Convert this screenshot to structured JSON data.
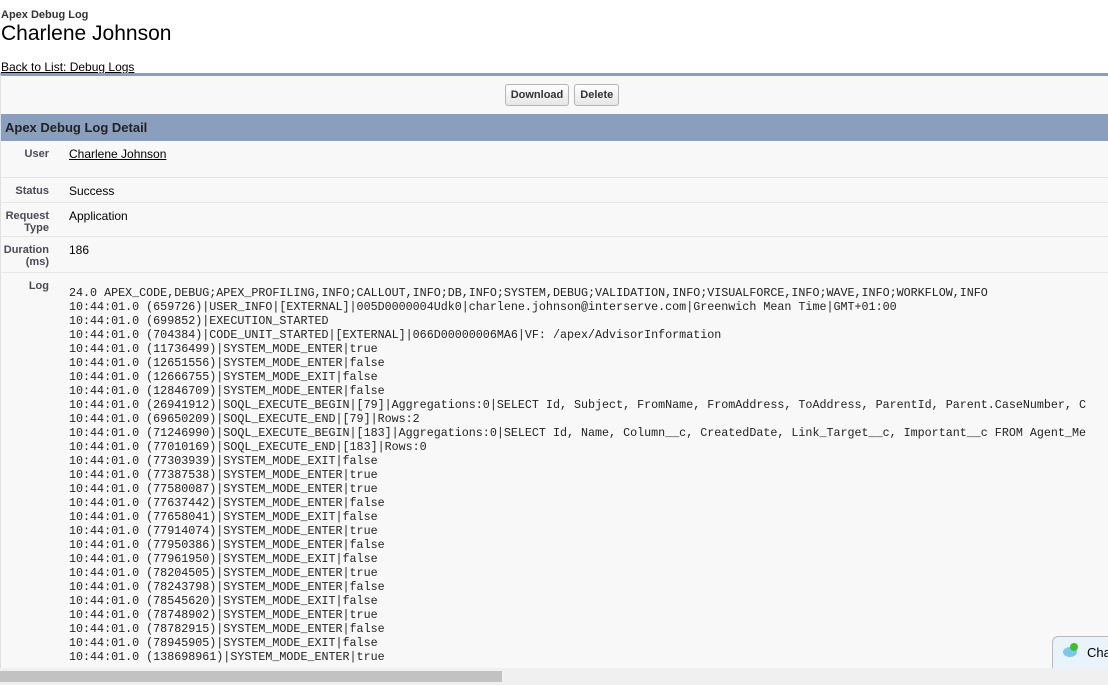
{
  "header": {
    "subtitle": "Apex Debug Log",
    "title": "Charlene Johnson",
    "back_link": "Back to List: Debug Logs"
  },
  "buttons": {
    "download": "Download",
    "delete": "Delete"
  },
  "section_title": "Apex Debug Log Detail",
  "fields": {
    "user_label": "User",
    "user_value": "Charlene Johnson",
    "status_label": "Status",
    "status_value": "Success",
    "request_type_label": "Request Type",
    "request_type_value": "Application",
    "duration_label": "Duration (ms)",
    "duration_value": "186",
    "log_label": "Log"
  },
  "log_lines": [
    "24.0 APEX_CODE,DEBUG;APEX_PROFILING,INFO;CALLOUT,INFO;DB,INFO;SYSTEM,DEBUG;VALIDATION,INFO;VISUALFORCE,INFO;WAVE,INFO;WORKFLOW,INFO",
    "10:44:01.0 (659726)|USER_INFO|[EXTERNAL]|005D0000004Udk0|charlene.johnson@interserve.com|Greenwich Mean Time|GMT+01:00",
    "10:44:01.0 (699852)|EXECUTION_STARTED",
    "10:44:01.0 (704384)|CODE_UNIT_STARTED|[EXTERNAL]|066D00000006MA6|VF: /apex/AdvisorInformation",
    "10:44:01.0 (11736499)|SYSTEM_MODE_ENTER|true",
    "10:44:01.0 (12651556)|SYSTEM_MODE_ENTER|false",
    "10:44:01.0 (12666755)|SYSTEM_MODE_EXIT|false",
    "10:44:01.0 (12846709)|SYSTEM_MODE_ENTER|false",
    "10:44:01.0 (26941912)|SOQL_EXECUTE_BEGIN|[79]|Aggregations:0|SELECT Id, Subject, FromName, FromAddress, ToAddress, ParentId, Parent.CaseNumber, C",
    "10:44:01.0 (69650209)|SOQL_EXECUTE_END|[79]|Rows:2",
    "10:44:01.0 (71246990)|SOQL_EXECUTE_BEGIN|[183]|Aggregations:0|SELECT Id, Name, Column__c, CreatedDate, Link_Target__c, Important__c FROM Agent_Me",
    "10:44:01.0 (77010169)|SOQL_EXECUTE_END|[183]|Rows:0",
    "10:44:01.0 (77303939)|SYSTEM_MODE_EXIT|false",
    "10:44:01.0 (77387538)|SYSTEM_MODE_ENTER|true",
    "10:44:01.0 (77580087)|SYSTEM_MODE_ENTER|true",
    "10:44:01.0 (77637442)|SYSTEM_MODE_ENTER|false",
    "10:44:01.0 (77658041)|SYSTEM_MODE_EXIT|false",
    "10:44:01.0 (77914074)|SYSTEM_MODE_ENTER|true",
    "10:44:01.0 (77950386)|SYSTEM_MODE_ENTER|false",
    "10:44:01.0 (77961950)|SYSTEM_MODE_EXIT|false",
    "10:44:01.0 (78204505)|SYSTEM_MODE_ENTER|true",
    "10:44:01.0 (78243798)|SYSTEM_MODE_ENTER|false",
    "10:44:01.0 (78545620)|SYSTEM_MODE_EXIT|false",
    "10:44:01.0 (78748902)|SYSTEM_MODE_ENTER|true",
    "10:44:01.0 (78782915)|SYSTEM_MODE_ENTER|false",
    "10:44:01.0 (78945905)|SYSTEM_MODE_EXIT|false",
    "10:44:01.0 (138698961)|SYSTEM_MODE_ENTER|true"
  ],
  "chat": {
    "label": "Cha"
  }
}
